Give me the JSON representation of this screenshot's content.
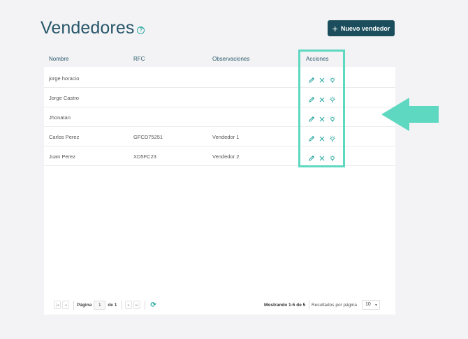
{
  "header": {
    "title": "Vendedores",
    "help_icon": "?",
    "new_button_plus": "+",
    "new_button_label": "Nuevo vendedor"
  },
  "table": {
    "columns": [
      "Nombre",
      "RFC",
      "Observaciones",
      "Acciones"
    ],
    "rows": [
      {
        "nombre": "jorge horacio",
        "rfc": "",
        "observaciones": ""
      },
      {
        "nombre": "Jorge Castro",
        "rfc": "",
        "observaciones": ""
      },
      {
        "nombre": "Jhonatan",
        "rfc": "",
        "observaciones": ""
      },
      {
        "nombre": "Carlos Perez",
        "rfc": "GFCD75251",
        "observaciones": "Vendedor 1"
      },
      {
        "nombre": "Juan Perez",
        "rfc": "XD5FC23",
        "observaciones": "Vendedor 2"
      }
    ],
    "action_icons": [
      "pencil-icon",
      "close-icon",
      "lightbulb-icon"
    ]
  },
  "pagination": {
    "page_label": "Página",
    "page_value": "1",
    "of_label": "de 1",
    "showing": "Mostrando 1-5 de 5",
    "results_label": "Resultados por página",
    "page_size": "10"
  },
  "colors": {
    "title": "#28566a",
    "button": "#1b4d5c",
    "accent": "#2aa8a0",
    "highlight": "#5ed8c0"
  }
}
